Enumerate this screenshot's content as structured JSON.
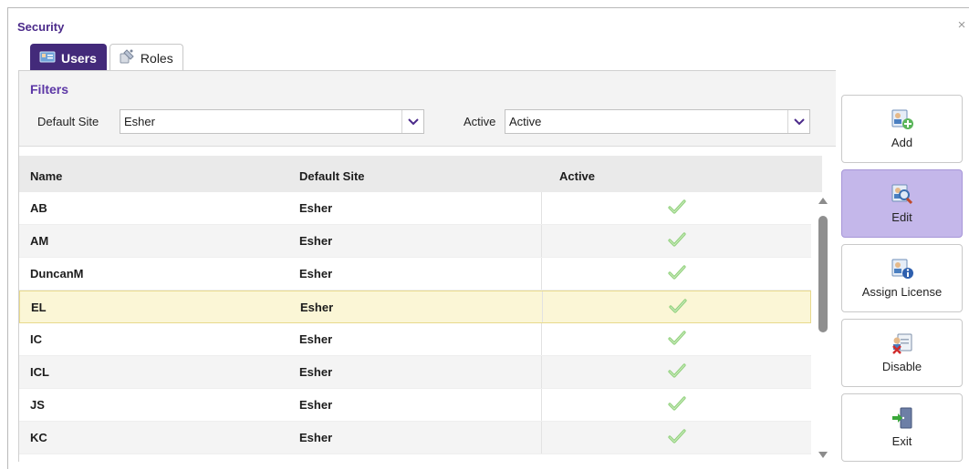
{
  "window": {
    "title": "Security",
    "close_glyph": "×"
  },
  "tabs": [
    {
      "label": "Users",
      "icon": "users-icon",
      "active": true
    },
    {
      "label": "Roles",
      "icon": "roles-icon",
      "active": false
    }
  ],
  "filters": {
    "title": "Filters",
    "default_site_label": "Default Site",
    "default_site_value": "Esher",
    "active_label": "Active",
    "active_value": "Active"
  },
  "grid": {
    "columns": [
      "Name",
      "Default Site",
      "Active"
    ],
    "rows": [
      {
        "name": "AB",
        "site": "Esher",
        "active": true
      },
      {
        "name": "AM",
        "site": "Esher",
        "active": true
      },
      {
        "name": "DuncanM",
        "site": "Esher",
        "active": true
      },
      {
        "name": "EL",
        "site": "Esher",
        "active": true,
        "selected": true
      },
      {
        "name": "IC",
        "site": "Esher",
        "active": true
      },
      {
        "name": "ICL",
        "site": "Esher",
        "active": true
      },
      {
        "name": "JS",
        "site": "Esher",
        "active": true
      },
      {
        "name": "KC",
        "site": "Esher",
        "active": true
      }
    ]
  },
  "actions": [
    {
      "label": "Add",
      "icon": "add-user-icon"
    },
    {
      "label": "Edit",
      "icon": "edit-user-icon",
      "active": true
    },
    {
      "label": "Assign License",
      "icon": "assign-license-icon"
    },
    {
      "label": "Disable",
      "icon": "disable-user-icon"
    },
    {
      "label": "Exit",
      "icon": "exit-icon"
    }
  ],
  "colors": {
    "accent": "#432a7a",
    "filters_title": "#5c37a6",
    "selected_row": "#fbf6d6",
    "active_action": "#c4b7ea",
    "check": "#8fd07a"
  }
}
